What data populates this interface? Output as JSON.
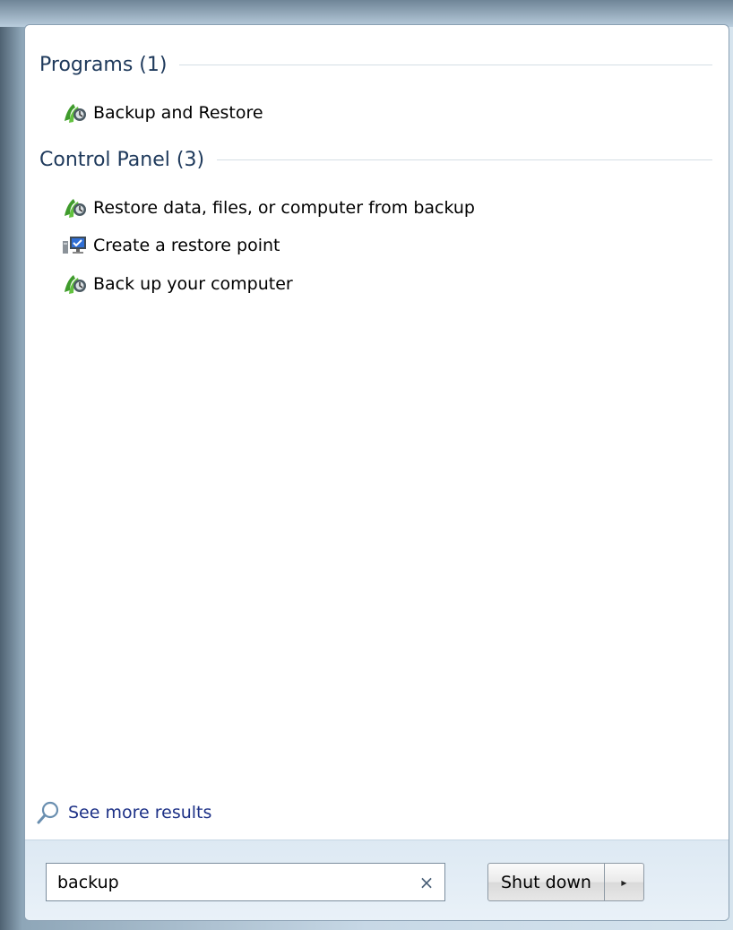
{
  "programs": {
    "header": "Programs (1)",
    "items": [
      {
        "label": "Backup and Restore",
        "icon": "backup-restore-icon"
      }
    ]
  },
  "control_panel": {
    "header": "Control Panel (3)",
    "items": [
      {
        "label": "Restore data, files, or computer from backup",
        "icon": "backup-restore-icon"
      },
      {
        "label": "Create a restore point",
        "icon": "system-protection-icon"
      },
      {
        "label": "Back up your computer",
        "icon": "backup-restore-icon"
      }
    ]
  },
  "see_more": {
    "label": "See more results",
    "icon": "search-icon"
  },
  "search": {
    "value": "backup",
    "clear_glyph": "×"
  },
  "power": {
    "label": "Shut down",
    "arrow_glyph": "▸"
  }
}
